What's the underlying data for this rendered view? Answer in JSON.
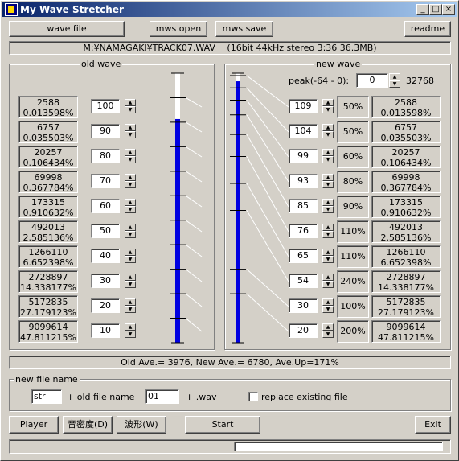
{
  "window": {
    "title": "My Wave Stretcher"
  },
  "toolbar": {
    "wave_file": "wave file",
    "mws_open": "mws open",
    "mws_save": "mws save",
    "readme": "readme"
  },
  "file_info": "M:¥NAMAGAKI¥TRACK07.WAV　 (16bit 44kHz stereo 3:36 36.3MB)",
  "old_wave": {
    "label": "old wave",
    "rows": [
      {
        "count": "2588",
        "percent": "0.013598%",
        "level": "100"
      },
      {
        "count": "6757",
        "percent": "0.035503%",
        "level": "90"
      },
      {
        "count": "20257",
        "percent": "0.106434%",
        "level": "80"
      },
      {
        "count": "69998",
        "percent": "0.367784%",
        "level": "70"
      },
      {
        "count": "173315",
        "percent": "0.910632%",
        "level": "60"
      },
      {
        "count": "492013",
        "percent": "2.585136%",
        "level": "50"
      },
      {
        "count": "1266110",
        "percent": "6.652398%",
        "level": "40"
      },
      {
        "count": "2728897",
        "percent": "14.338177%",
        "level": "30"
      },
      {
        "count": "5172835",
        "percent": "27.179123%",
        "level": "20"
      },
      {
        "count": "9099614",
        "percent": "47.811215%",
        "level": "10"
      }
    ],
    "fill_fraction": 0.83
  },
  "new_wave": {
    "label": "new wave",
    "peak_label": "peak(-64 - 0):",
    "peak_value": "0",
    "peak_max": "32768",
    "rows": [
      {
        "level": "109",
        "ratio": "50%",
        "count": "2588",
        "percent": "0.013598%"
      },
      {
        "level": "104",
        "ratio": "50%",
        "count": "6757",
        "percent": "0.035503%"
      },
      {
        "level": "99",
        "ratio": "60%",
        "count": "20257",
        "percent": "0.106434%"
      },
      {
        "level": "93",
        "ratio": "80%",
        "count": "69998",
        "percent": "0.367784%"
      },
      {
        "level": "85",
        "ratio": "90%",
        "count": "173315",
        "percent": "0.910632%"
      },
      {
        "level": "76",
        "ratio": "110%",
        "count": "492013",
        "percent": "2.585136%"
      },
      {
        "level": "65",
        "ratio": "110%",
        "count": "1266110",
        "percent": "6.652398%"
      },
      {
        "level": "54",
        "ratio": "240%",
        "count": "2728897",
        "percent": "14.338177%"
      },
      {
        "level": "30",
        "ratio": "100%",
        "count": "5172835",
        "percent": "27.179123%"
      },
      {
        "level": "20",
        "ratio": "200%",
        "count": "9099614",
        "percent": "47.811215%"
      }
    ],
    "fill_fraction": 0.97
  },
  "summary": "Old Ave.= 3976, New Ave.= 6780, Ave.Up=171%",
  "new_file_name": {
    "label": "new file name",
    "prefix": "str",
    "plus_old": "+ old file name +",
    "suffix": "01",
    "ext": "+ .wav",
    "replace_label": "replace existing file",
    "replace_checked": false
  },
  "bottom": {
    "player": "Player",
    "density": "音密度(D)",
    "waveform": "波形(W)",
    "start": "Start",
    "exit": "Exit"
  },
  "progress": 0,
  "colors": {
    "bar": "#0000e0",
    "title_start": "#0a246a",
    "title_end": "#a6caf0"
  }
}
